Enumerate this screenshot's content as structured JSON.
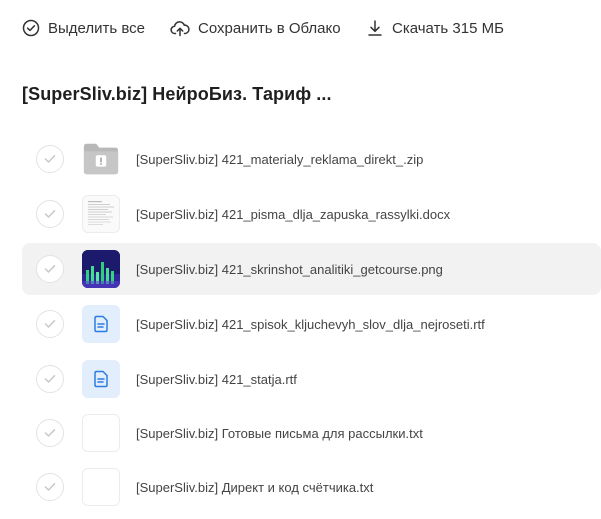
{
  "toolbar": {
    "select_all_label": "Выделить все",
    "save_cloud_label": "Сохранить в Облако",
    "download_label": "Скачать 315 МБ"
  },
  "folder_title": "[SuperSliv.biz] НейроБиз. Тариф ...",
  "files": [
    {
      "name": "[SuperSliv.biz] 421_materialy_reklama_direkt_.zip",
      "type": "zip"
    },
    {
      "name": "[SuperSliv.biz] 421_pisma_dlja_zapuska_rassylki.docx",
      "type": "docx"
    },
    {
      "name": "[SuperSliv.biz] 421_skrinshot_analitiki_getcourse.png",
      "type": "png"
    },
    {
      "name": "[SuperSliv.biz] 421_spisok_kljuchevyh_slov_dlja_nejroseti.rtf",
      "type": "rtf"
    },
    {
      "name": "[SuperSliv.biz] 421_statja.rtf",
      "type": "rtf"
    },
    {
      "name": "[SuperSliv.biz] Готовые письма для рассылки.txt",
      "type": "txt"
    },
    {
      "name": "[SuperSliv.biz] Директ и код счётчика.txt",
      "type": "txt"
    }
  ],
  "colors": {
    "accent": "#2b7be5",
    "hover_row": "#f2f2f2",
    "rtf_tile": "#e3eefc"
  }
}
